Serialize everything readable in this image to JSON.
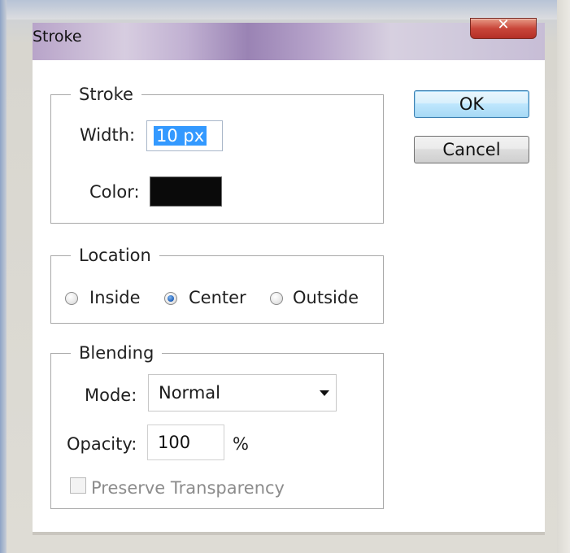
{
  "window": {
    "title": "Stroke",
    "close_icon": "✕"
  },
  "stroke_group": {
    "legend": "Stroke",
    "width_label": "Width:",
    "width_value": "10 px",
    "color_label": "Color:",
    "color_value": "#0a0a0a"
  },
  "location_group": {
    "legend": "Location",
    "options": [
      {
        "label": "Inside",
        "checked": false
      },
      {
        "label": "Center",
        "checked": true
      },
      {
        "label": "Outside",
        "checked": false
      }
    ]
  },
  "blending_group": {
    "legend": "Blending",
    "mode_label": "Mode:",
    "mode_value": "Normal",
    "opacity_label": "Opacity:",
    "opacity_value": "100",
    "opacity_unit": "%",
    "preserve_label": "Preserve Transparency",
    "preserve_checked": false,
    "preserve_enabled": false
  },
  "buttons": {
    "ok_label": "OK",
    "cancel_label": "Cancel"
  }
}
